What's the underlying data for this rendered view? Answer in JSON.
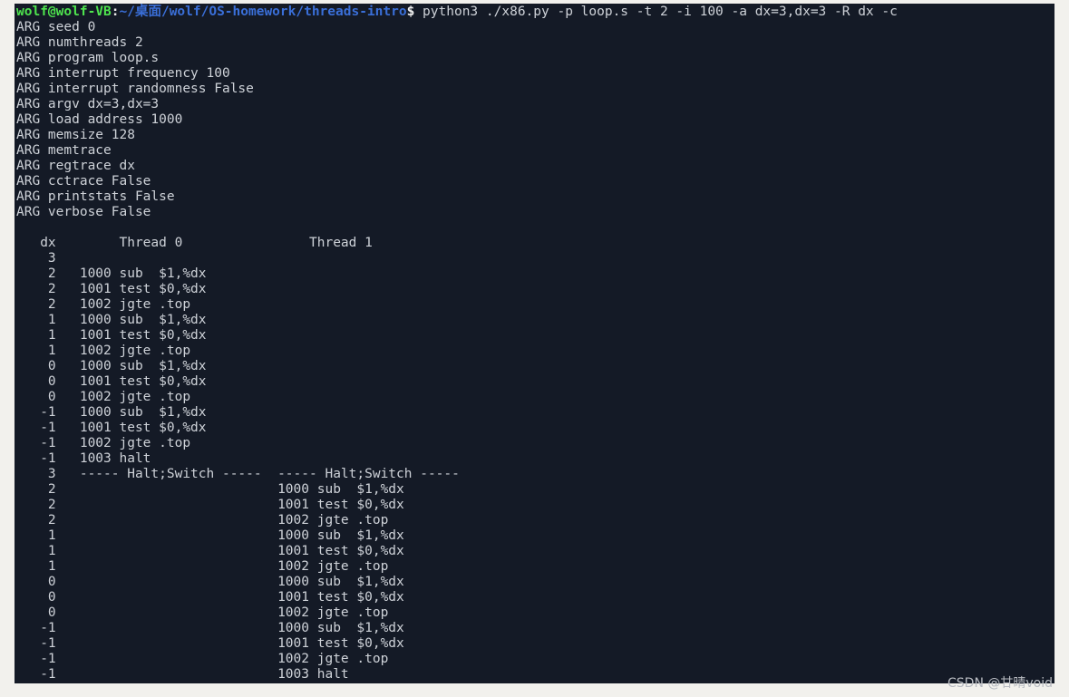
{
  "terminal": {
    "background_color": "#141a26",
    "text_color": "#ced2d8",
    "page_background_color": "#f2f1ed",
    "prompt": {
      "user_host": "wolf@wolf-VB",
      "user_host_color": "#4ee44e",
      "separator": ":",
      "path": "~/桌面/wolf/OS-homework/threads-intro",
      "path_color": "#3a6fd8",
      "dollar": "$",
      "command": " python3 ./x86.py -p loop.s -t 2 -i 100 -a dx=3,dx=3 -R dx -c"
    },
    "args": [
      "ARG seed 0",
      "ARG numthreads 2",
      "ARG program loop.s",
      "ARG interrupt frequency 100",
      "ARG interrupt randomness False",
      "ARG argv dx=3,dx=3",
      "ARG load address 1000",
      "ARG memsize 128",
      "ARG memtrace",
      "ARG regtrace dx",
      "ARG cctrace False",
      "ARG printstats False",
      "ARG verbose False"
    ],
    "blank_after_args": "",
    "trace_header": {
      "reg_column": "dx",
      "thread0": "Thread 0",
      "thread1": "Thread 1"
    },
    "trace_lines": [
      "    3",
      "    2   1000 sub  $1,%dx",
      "    2   1001 test $0,%dx",
      "    2   1002 jgte .top",
      "    1   1000 sub  $1,%dx",
      "    1   1001 test $0,%dx",
      "    1   1002 jgte .top",
      "    0   1000 sub  $1,%dx",
      "    0   1001 test $0,%dx",
      "    0   1002 jgte .top",
      "   -1   1000 sub  $1,%dx",
      "   -1   1001 test $0,%dx",
      "   -1   1002 jgte .top",
      "   -1   1003 halt",
      "    3   ----- Halt;Switch -----  ----- Halt;Switch -----",
      "    2                            1000 sub  $1,%dx",
      "    2                            1001 test $0,%dx",
      "    2                            1002 jgte .top",
      "    1                            1000 sub  $1,%dx",
      "    1                            1001 test $0,%dx",
      "    1                            1002 jgte .top",
      "    0                            1000 sub  $1,%dx",
      "    0                            1001 test $0,%dx",
      "    0                            1002 jgte .top",
      "   -1                            1000 sub  $1,%dx",
      "   -1                            1001 test $0,%dx",
      "   -1                            1002 jgte .top",
      "   -1                            1003 halt"
    ],
    "header_line": "   dx        Thread 0                Thread 1"
  },
  "watermark": {
    "text": "CSDN @甘晴void",
    "color": "#b9bcc2"
  }
}
